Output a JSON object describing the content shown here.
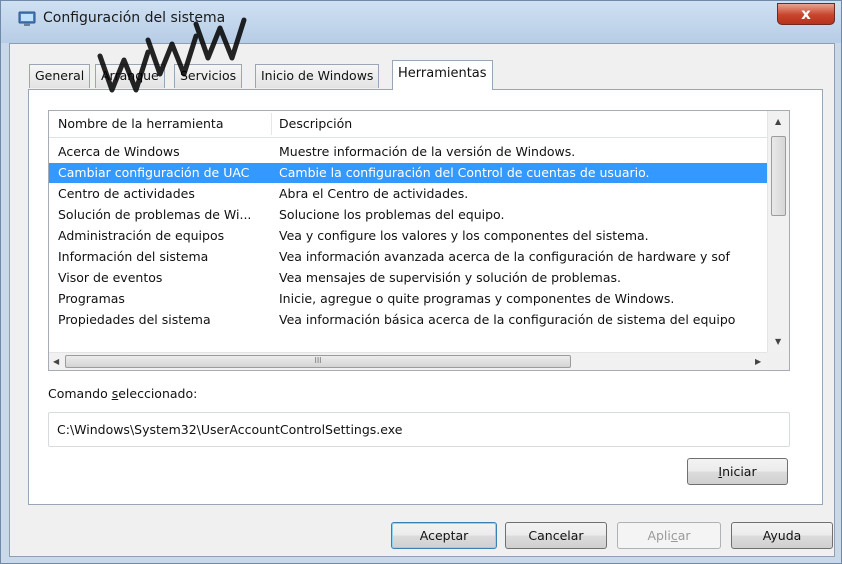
{
  "window": {
    "title": "Configuración del sistema",
    "icon": "system-config-icon",
    "close_glyph": "x"
  },
  "tabs": [
    {
      "label": "General",
      "active": false
    },
    {
      "label": "Arranque",
      "active": false
    },
    {
      "label": "Servicios",
      "active": false
    },
    {
      "label": "Inicio de Windows",
      "active": false
    },
    {
      "label": "Herramientas",
      "active": true
    }
  ],
  "tools": {
    "columns": [
      "Nombre de la herramienta",
      "Descripción"
    ],
    "rows": [
      {
        "name": "Acerca de Windows",
        "description": "Muestre información de la versión de Windows."
      },
      {
        "name": "Cambiar configuración de UAC",
        "description": "Cambie la configuración del Control de cuentas de usuario.",
        "selected": true
      },
      {
        "name": "Centro de actividades",
        "description": "Abra el Centro de actividades."
      },
      {
        "name": "Solución de problemas de Wi...",
        "description": "Solucione los problemas del equipo."
      },
      {
        "name": "Administración de equipos",
        "description": "Vea y configure los valores y los componentes del sistema."
      },
      {
        "name": "Información del sistema",
        "description": "Vea información avanzada acerca de la configuración de hardware y sof"
      },
      {
        "name": "Visor de eventos",
        "description": "Vea mensajes de supervisión y solución de problemas."
      },
      {
        "name": "Programas",
        "description": "Inicie, agregue o quite programas y componentes de Windows."
      },
      {
        "name": "Propiedades del sistema",
        "description": "Vea información básica acerca de la configuración de sistema del equipo"
      }
    ]
  },
  "command": {
    "label_prefix": "Comando ",
    "label_accel": "s",
    "label_rest": "eleccionado:",
    "value": "C:\\Windows\\System32\\UserAccountControlSettings.exe"
  },
  "buttons": {
    "launch": {
      "accel": "I",
      "rest": "niciar"
    },
    "ok": "Aceptar",
    "cancel": "Cancelar",
    "apply": {
      "prefix": "Apli",
      "accel": "c",
      "rest": "ar",
      "disabled": true
    },
    "help": "Ayuda"
  },
  "scrollbar": {
    "h_thumb_grip": "III"
  },
  "watermark": {
    "visible": true,
    "color": "#000000"
  },
  "colors": {
    "selection": "#3399ff",
    "close_button": "#c8442c"
  }
}
